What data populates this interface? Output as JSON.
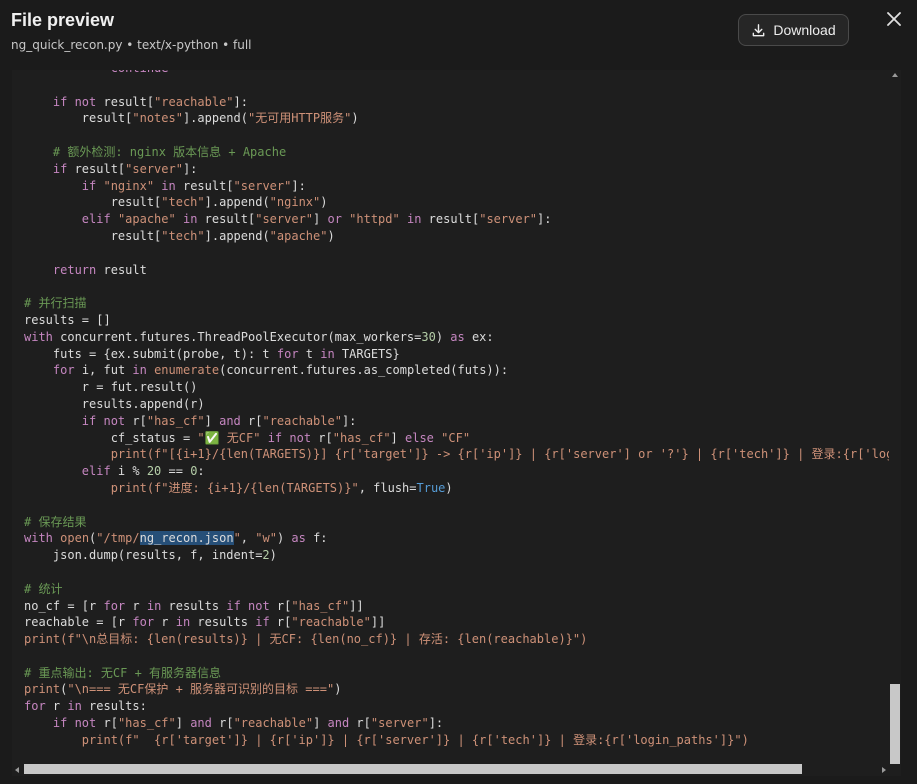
{
  "header": {
    "title": "File preview",
    "subtitle": "ng_quick_recon.py • text/x-python • full",
    "download_label": "Download"
  },
  "code": {
    "language": "python",
    "lines": [
      [
        {
          "t": "            continue",
          "c": "kw"
        }
      ],
      [],
      [
        {
          "t": "    "
        },
        {
          "t": "if not",
          "c": "kw"
        },
        {
          "t": " result["
        },
        {
          "t": "\"reachable\"",
          "c": "str"
        },
        {
          "t": "]:"
        }
      ],
      [
        {
          "t": "        result["
        },
        {
          "t": "\"notes\"",
          "c": "str"
        },
        {
          "t": "].append("
        },
        {
          "t": "\"无可用HTTP服务\"",
          "c": "str"
        },
        {
          "t": ")"
        }
      ],
      [],
      [
        {
          "t": "    # 额外检测: nginx 版本信息 + Apache",
          "c": "cmt"
        }
      ],
      [
        {
          "t": "    "
        },
        {
          "t": "if",
          "c": "kw"
        },
        {
          "t": " result["
        },
        {
          "t": "\"server\"",
          "c": "str"
        },
        {
          "t": "]:"
        }
      ],
      [
        {
          "t": "        "
        },
        {
          "t": "if",
          "c": "kw"
        },
        {
          "t": " "
        },
        {
          "t": "\"nginx\"",
          "c": "str"
        },
        {
          "t": " "
        },
        {
          "t": "in",
          "c": "kw"
        },
        {
          "t": " result["
        },
        {
          "t": "\"server\"",
          "c": "str"
        },
        {
          "t": "]:"
        }
      ],
      [
        {
          "t": "            result["
        },
        {
          "t": "\"tech\"",
          "c": "str"
        },
        {
          "t": "].append("
        },
        {
          "t": "\"nginx\"",
          "c": "str"
        },
        {
          "t": ")"
        }
      ],
      [
        {
          "t": "        "
        },
        {
          "t": "elif",
          "c": "kw"
        },
        {
          "t": " "
        },
        {
          "t": "\"apache\"",
          "c": "str"
        },
        {
          "t": " "
        },
        {
          "t": "in",
          "c": "kw"
        },
        {
          "t": " result["
        },
        {
          "t": "\"server\"",
          "c": "str"
        },
        {
          "t": "] "
        },
        {
          "t": "or",
          "c": "kw"
        },
        {
          "t": " "
        },
        {
          "t": "\"httpd\"",
          "c": "str"
        },
        {
          "t": " "
        },
        {
          "t": "in",
          "c": "kw"
        },
        {
          "t": " result["
        },
        {
          "t": "\"server\"",
          "c": "str"
        },
        {
          "t": "]:"
        }
      ],
      [
        {
          "t": "            result["
        },
        {
          "t": "\"tech\"",
          "c": "str"
        },
        {
          "t": "].append("
        },
        {
          "t": "\"apache\"",
          "c": "str"
        },
        {
          "t": ")"
        }
      ],
      [],
      [
        {
          "t": "    "
        },
        {
          "t": "return",
          "c": "kw"
        },
        {
          "t": " result"
        }
      ],
      [],
      [
        {
          "t": "# 并行扫描",
          "c": "cmt"
        }
      ],
      [
        {
          "t": "results = []"
        }
      ],
      [
        {
          "t": "with",
          "c": "kw"
        },
        {
          "t": " concurrent.futures.ThreadPoolExecutor(max_workers="
        },
        {
          "t": "30",
          "c": "num"
        },
        {
          "t": ") "
        },
        {
          "t": "as",
          "c": "kw"
        },
        {
          "t": " ex:"
        }
      ],
      [
        {
          "t": "    futs = {ex.submit(probe, t): t "
        },
        {
          "t": "for",
          "c": "kw"
        },
        {
          "t": " t "
        },
        {
          "t": "in",
          "c": "kw"
        },
        {
          "t": " TARGETS}"
        }
      ],
      [
        {
          "t": "    "
        },
        {
          "t": "for",
          "c": "kw"
        },
        {
          "t": " i, fut "
        },
        {
          "t": "in",
          "c": "kw"
        },
        {
          "t": " "
        },
        {
          "t": "enumerate",
          "c": "str"
        },
        {
          "t": "(concurrent.futures.as_completed(futs)):"
        }
      ],
      [
        {
          "t": "        r = fut.result()"
        }
      ],
      [
        {
          "t": "        results.append(r)"
        }
      ],
      [
        {
          "t": "        "
        },
        {
          "t": "if not",
          "c": "kw"
        },
        {
          "t": " r["
        },
        {
          "t": "\"has_cf\"",
          "c": "str"
        },
        {
          "t": "] "
        },
        {
          "t": "and",
          "c": "kw"
        },
        {
          "t": " r["
        },
        {
          "t": "\"reachable\"",
          "c": "str"
        },
        {
          "t": "]:"
        }
      ],
      [
        {
          "t": "            cf_status = "
        },
        {
          "t": "\"✅ 无CF\"",
          "c": "str"
        },
        {
          "t": " "
        },
        {
          "t": "if not",
          "c": "kw"
        },
        {
          "t": " r["
        },
        {
          "t": "\"has_cf\"",
          "c": "str"
        },
        {
          "t": "] "
        },
        {
          "t": "else",
          "c": "kw"
        },
        {
          "t": " "
        },
        {
          "t": "\"CF\"",
          "c": "str"
        }
      ],
      [
        {
          "t": "            "
        },
        {
          "t": "print",
          "c": "str"
        },
        {
          "t": "(f\"[{i+1}/{",
          "c": "str"
        },
        {
          "t": "len",
          "c": "str"
        },
        {
          "t": "(TARGETS)}] {r['target']} -> {r['ip']} | {r['server'] or '?'} | {r['tech']} | 登录:{r['login_paths']}\")",
          "c": "str"
        }
      ],
      [
        {
          "t": "        "
        },
        {
          "t": "elif",
          "c": "kw"
        },
        {
          "t": " i % "
        },
        {
          "t": "20",
          "c": "num"
        },
        {
          "t": " == "
        },
        {
          "t": "0",
          "c": "num"
        },
        {
          "t": ":"
        }
      ],
      [
        {
          "t": "            "
        },
        {
          "t": "print",
          "c": "str"
        },
        {
          "t": "(f\"进度: {i+1}/{",
          "c": "str"
        },
        {
          "t": "len",
          "c": "str"
        },
        {
          "t": "(TARGETS)}\"",
          "c": "str"
        },
        {
          "t": ", flush="
        },
        {
          "t": "True",
          "c": "kwb"
        },
        {
          "t": ")"
        }
      ],
      [],
      [
        {
          "t": "# 保存结果",
          "c": "cmt"
        }
      ],
      [
        {
          "t": "with",
          "c": "kw"
        },
        {
          "t": " "
        },
        {
          "t": "open",
          "c": "str"
        },
        {
          "t": "("
        },
        {
          "t": "\"/tmp/",
          "c": "str"
        },
        {
          "t": "ng_recon.json",
          "c": "sel"
        },
        {
          "t": "\"",
          "c": "str"
        },
        {
          "t": ", "
        },
        {
          "t": "\"w\"",
          "c": "str"
        },
        {
          "t": ") "
        },
        {
          "t": "as",
          "c": "kw"
        },
        {
          "t": " f:"
        }
      ],
      [
        {
          "t": "    json.dump(results, f, indent="
        },
        {
          "t": "2",
          "c": "num"
        },
        {
          "t": ")"
        }
      ],
      [],
      [
        {
          "t": "# 统计",
          "c": "cmt"
        }
      ],
      [
        {
          "t": "no_cf = [r "
        },
        {
          "t": "for",
          "c": "kw"
        },
        {
          "t": " r "
        },
        {
          "t": "in",
          "c": "kw"
        },
        {
          "t": " results "
        },
        {
          "t": "if not",
          "c": "kw"
        },
        {
          "t": " r["
        },
        {
          "t": "\"has_cf\"",
          "c": "str"
        },
        {
          "t": "]]"
        }
      ],
      [
        {
          "t": "reachable = [r "
        },
        {
          "t": "for",
          "c": "kw"
        },
        {
          "t": " r "
        },
        {
          "t": "in",
          "c": "kw"
        },
        {
          "t": " results "
        },
        {
          "t": "if",
          "c": "kw"
        },
        {
          "t": " r["
        },
        {
          "t": "\"reachable\"",
          "c": "str"
        },
        {
          "t": "]]"
        }
      ],
      [
        {
          "t": "print",
          "c": "str"
        },
        {
          "t": "(f\"\\n总目标: {",
          "c": "str"
        },
        {
          "t": "len",
          "c": "str"
        },
        {
          "t": "(results)} | 无CF: {",
          "c": "str"
        },
        {
          "t": "len",
          "c": "str"
        },
        {
          "t": "(no_cf)} | 存活: {",
          "c": "str"
        },
        {
          "t": "len",
          "c": "str"
        },
        {
          "t": "(reachable)}\")",
          "c": "str"
        }
      ],
      [],
      [
        {
          "t": "# 重点输出: 无CF + 有服务器信息",
          "c": "cmt"
        }
      ],
      [
        {
          "t": "print",
          "c": "str"
        },
        {
          "t": "("
        },
        {
          "t": "\"\\n=== 无CF保护 + 服务器可识别的目标 ===\"",
          "c": "str"
        },
        {
          "t": ")"
        }
      ],
      [
        {
          "t": "for",
          "c": "kw"
        },
        {
          "t": " r "
        },
        {
          "t": "in",
          "c": "kw"
        },
        {
          "t": " results:"
        }
      ],
      [
        {
          "t": "    "
        },
        {
          "t": "if not",
          "c": "kw"
        },
        {
          "t": " r["
        },
        {
          "t": "\"has_cf\"",
          "c": "str"
        },
        {
          "t": "] "
        },
        {
          "t": "and",
          "c": "kw"
        },
        {
          "t": " r["
        },
        {
          "t": "\"reachable\"",
          "c": "str"
        },
        {
          "t": "] "
        },
        {
          "t": "and",
          "c": "kw"
        },
        {
          "t": " r["
        },
        {
          "t": "\"server\"",
          "c": "str"
        },
        {
          "t": "]:"
        }
      ],
      [
        {
          "t": "        "
        },
        {
          "t": "print",
          "c": "str"
        },
        {
          "t": "(f\"  {r['target']} | {r['ip']} | {r['server']} | {r['tech']} | 登录:{r['login_paths']}\")",
          "c": "str"
        }
      ]
    ]
  },
  "colors": {
    "background": "#1b1b1b",
    "code_background": "#1e1e1e",
    "keyword": "#c586c0",
    "string": "#ce9178",
    "comment": "#6a9955",
    "selection": "#264f78"
  },
  "icons": {
    "download": "download-icon",
    "close": "close-icon"
  }
}
